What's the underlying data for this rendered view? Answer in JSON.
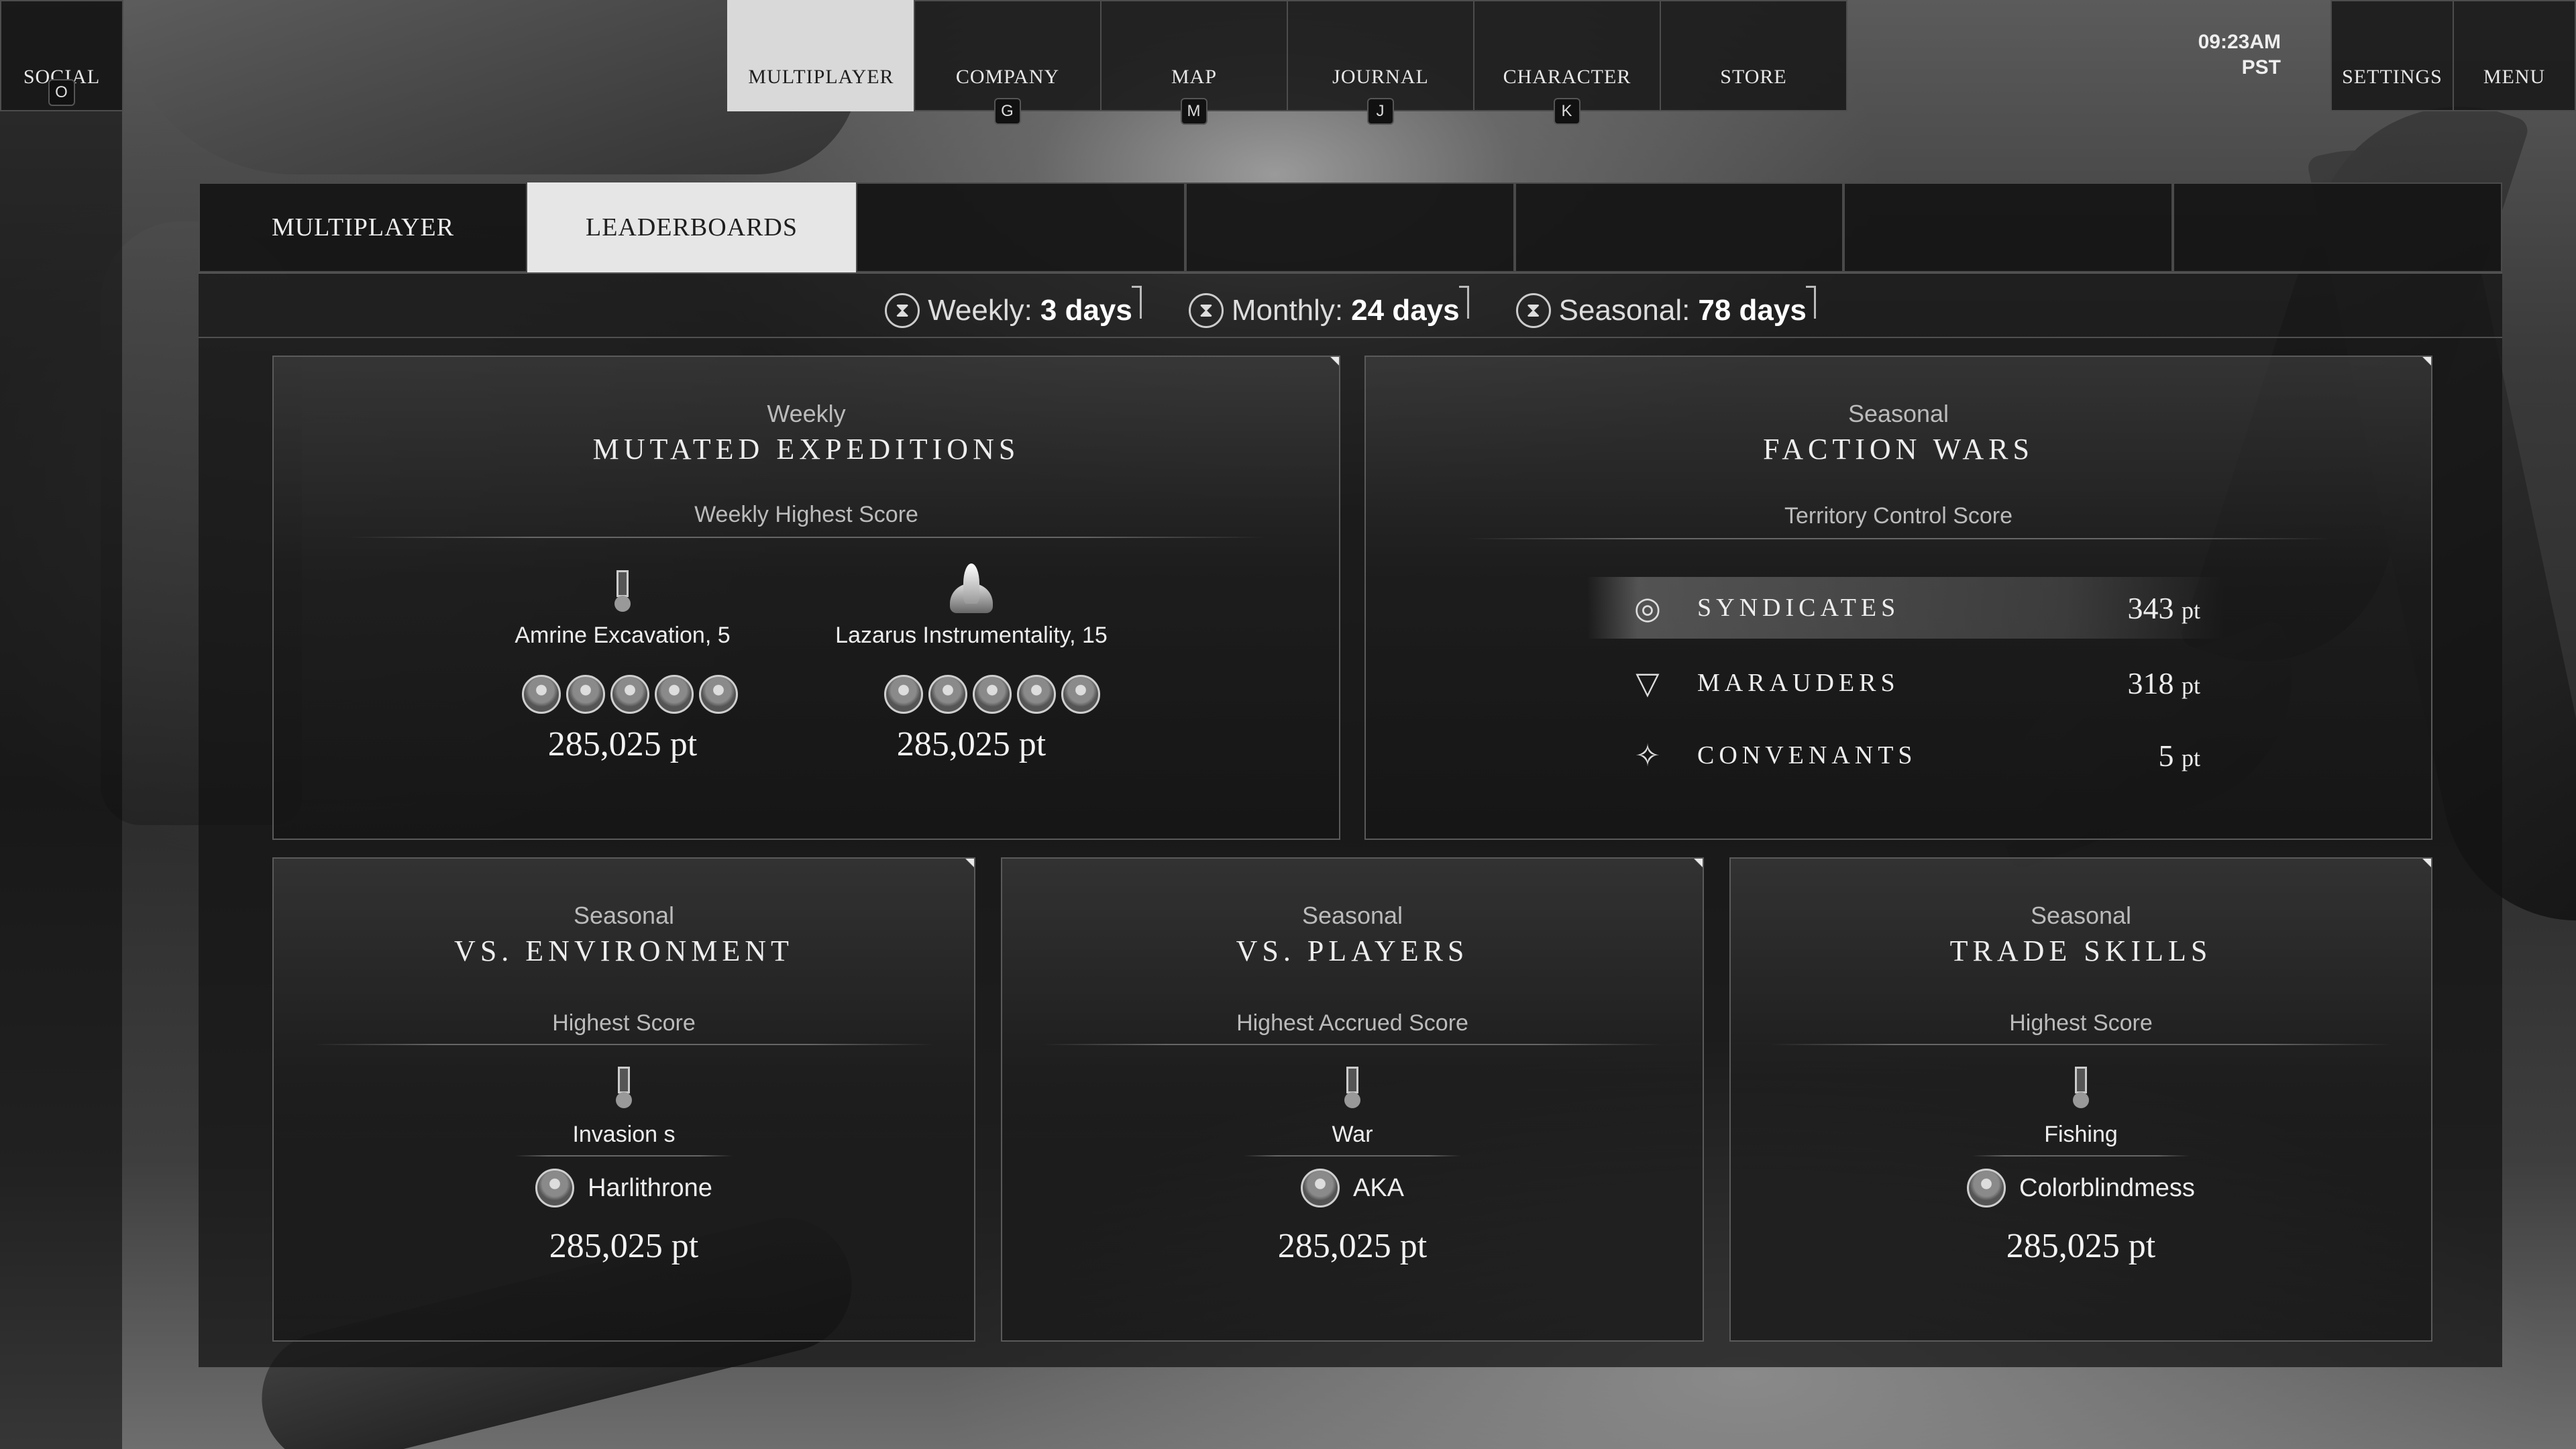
{
  "nav": {
    "social": {
      "label": "SOCIAL",
      "key": "O"
    },
    "items": [
      {
        "label": "MULTIPLAYER",
        "key": ""
      },
      {
        "label": "COMPANY",
        "key": "G"
      },
      {
        "label": "MAP",
        "key": "M"
      },
      {
        "label": "JOURNAL",
        "key": "J"
      },
      {
        "label": "CHARACTER",
        "key": "K"
      },
      {
        "label": "STORE",
        "key": ""
      }
    ],
    "clock_time": "09:23AM",
    "clock_zone": "PST",
    "settings": "SETTINGS",
    "menu": "MENU"
  },
  "tabs": {
    "multiplayer": "MULTIPLAYER",
    "leaderboards": "LEADERBOARDS"
  },
  "timers": [
    {
      "label": "Weekly:",
      "value": "3 days"
    },
    {
      "label": "Monthly:",
      "value": "24 days"
    },
    {
      "label": "Seasonal:",
      "value": "78 days"
    }
  ],
  "cards": {
    "expeditions": {
      "period": "Weekly",
      "title": "MUTATED EXPEDITIONS",
      "metric": "Weekly Highest Score",
      "entries": [
        {
          "name": "Amrine Excavation, 5",
          "score": "285,025 pt"
        },
        {
          "name": "Lazarus Instrumentality, 15",
          "score": "285,025 pt"
        }
      ]
    },
    "faction": {
      "period": "Seasonal",
      "title": "FACTION WARS",
      "metric": "Territory Control Score",
      "rows": [
        {
          "name": "SYNDICATES",
          "points": "343",
          "unit": "pt"
        },
        {
          "name": "MARAUDERS",
          "points": "318",
          "unit": "pt"
        },
        {
          "name": "CONVENANTS",
          "points": "5",
          "unit": "pt"
        }
      ]
    },
    "environment": {
      "period": "Seasonal",
      "title": "VS. ENVIRONMENT",
      "metric": "Highest Score",
      "category": "Invasion s",
      "player": "Harlithrone",
      "score": "285,025 pt"
    },
    "players": {
      "period": "Seasonal",
      "title": "VS. PLAYERS",
      "metric": "Highest Accrued Score",
      "category": "War",
      "player": "AKA",
      "score": "285,025 pt"
    },
    "trade": {
      "period": "Seasonal",
      "title": "TRADE SKILLS",
      "metric": "Highest Score",
      "category": "Fishing",
      "player": "Colorblindmess",
      "score": "285,025 pt"
    }
  }
}
